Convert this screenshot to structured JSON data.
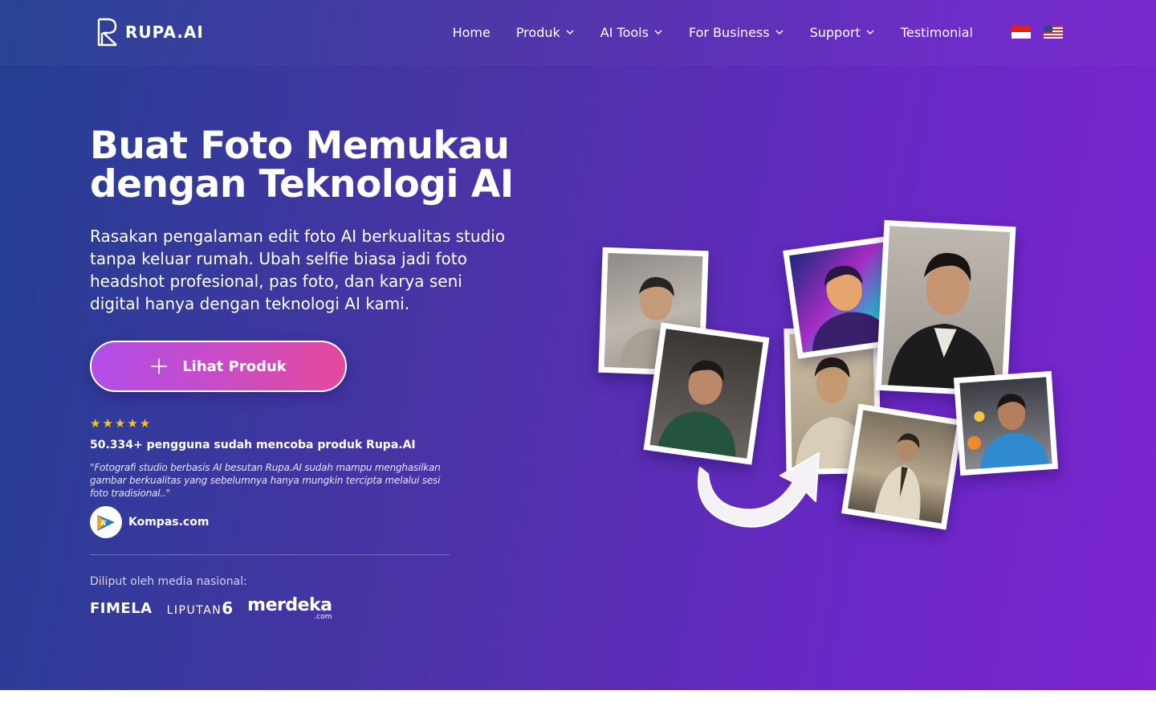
{
  "brand": {
    "logo_text": "RUPA.AI"
  },
  "nav": {
    "items": [
      {
        "label": "Home",
        "has_dropdown": false
      },
      {
        "label": "Produk",
        "has_dropdown": true
      },
      {
        "label": "AI Tools",
        "has_dropdown": true
      },
      {
        "label": "For Business",
        "has_dropdown": true
      },
      {
        "label": "Support",
        "has_dropdown": true
      },
      {
        "label": "Testimonial",
        "has_dropdown": false
      }
    ],
    "languages": [
      "indonesia-flag-icon",
      "us-flag-icon"
    ]
  },
  "hero": {
    "headline_line1": "Buat Foto Memukau",
    "headline_line2": "dengan Teknologi AI",
    "subtitle": "Rasakan pengalaman edit foto AI berkualitas studio tanpa keluar rumah. Ubah selfie biasa jadi foto headshot profesional, pas foto, dan karya seni digital hanya dengan teknologi AI kami.",
    "cta_label": "Lihat Produk",
    "rating_stars": 5,
    "users_text": "50.334+ pengguna sudah mencoba produk Rupa.AI",
    "quote": "\"Fotografi studio berbasis AI besutan Rupa.AI sudah mampu menghasilkan gambar berkualitas yang sebelumnya hanya mungkin tercipta melalui sesi foto tradisional..\"",
    "quote_source": "Kompas.com",
    "media_label": "Diliput oleh media nasional:",
    "media_logos": {
      "fimela": "FIMELA",
      "liputan": "LIPUTAN",
      "liputan_num": "6",
      "merdeka": "merdeka",
      "merdeka_suffix": ".com"
    }
  },
  "colors": {
    "gradient_start": "#243f93",
    "gradient_end": "#7c24cf",
    "cta_start": "#b04ee8",
    "cta_end": "#e44a9c",
    "star": "#f9c21c"
  }
}
